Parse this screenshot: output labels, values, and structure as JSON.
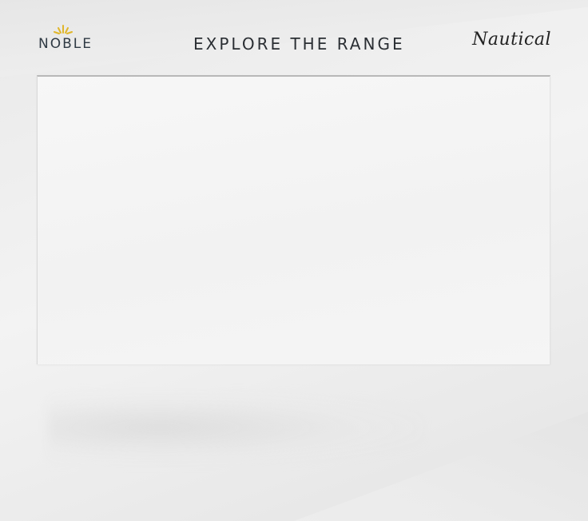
{
  "header": {
    "logo_text": "NOBLE",
    "logo_icon": "sunburst-icon",
    "title": "EXPLORE THE RANGE",
    "collection_script": "Nautical"
  },
  "colors": {
    "logo_accent": "#e0b62a",
    "title_text": "#2a2e33",
    "logo_text": "#2f3a44",
    "panel_border": "#b8b8b8"
  }
}
